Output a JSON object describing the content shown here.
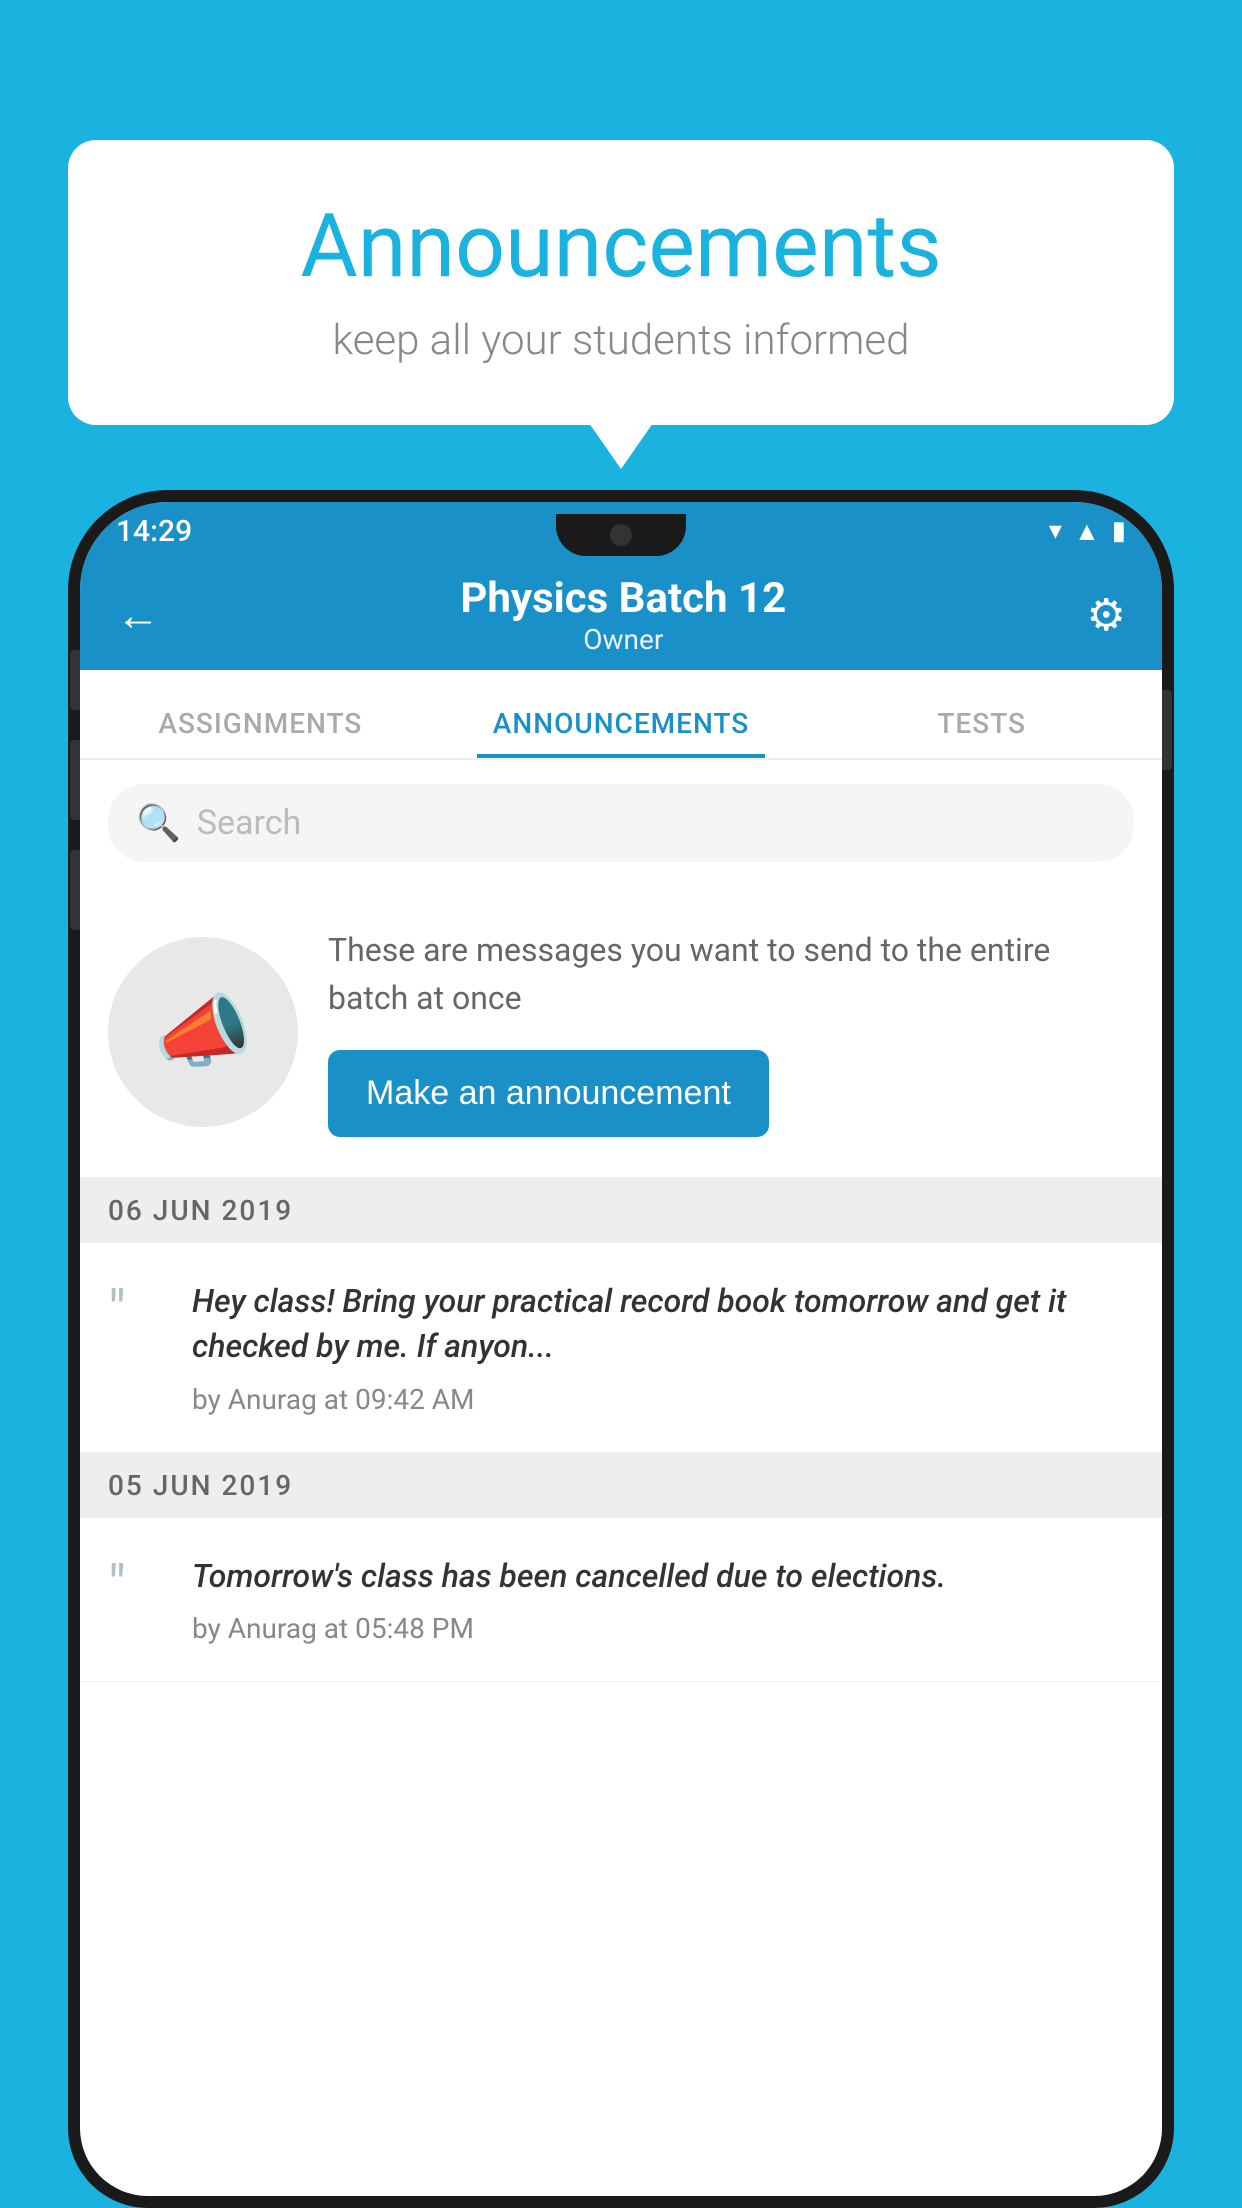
{
  "background_color": "#1ab3e0",
  "speech_bubble": {
    "title": "Announcements",
    "subtitle": "keep all your students informed"
  },
  "status_bar": {
    "time": "14:29",
    "icons": [
      "wifi",
      "signal",
      "battery"
    ]
  },
  "app_header": {
    "title": "Physics Batch 12",
    "subtitle": "Owner",
    "back_label": "←",
    "gear_label": "⚙"
  },
  "tabs": [
    {
      "label": "ASSIGNMENTS",
      "active": false
    },
    {
      "label": "ANNOUNCEMENTS",
      "active": true
    },
    {
      "label": "TESTS",
      "active": false
    }
  ],
  "search": {
    "placeholder": "Search"
  },
  "announcement_placeholder": {
    "description": "These are messages you want to send to the entire batch at once",
    "button_label": "Make an announcement"
  },
  "date_groups": [
    {
      "date": "06  JUN  2019",
      "items": [
        {
          "text": "Hey class! Bring your practical record book tomorrow and get it checked by me. If anyon...",
          "meta": "by Anurag at 09:42 AM"
        }
      ]
    },
    {
      "date": "05  JUN  2019",
      "items": [
        {
          "text": "Tomorrow's class has been cancelled due to elections.",
          "meta": "by Anurag at 05:48 PM"
        }
      ]
    }
  ]
}
